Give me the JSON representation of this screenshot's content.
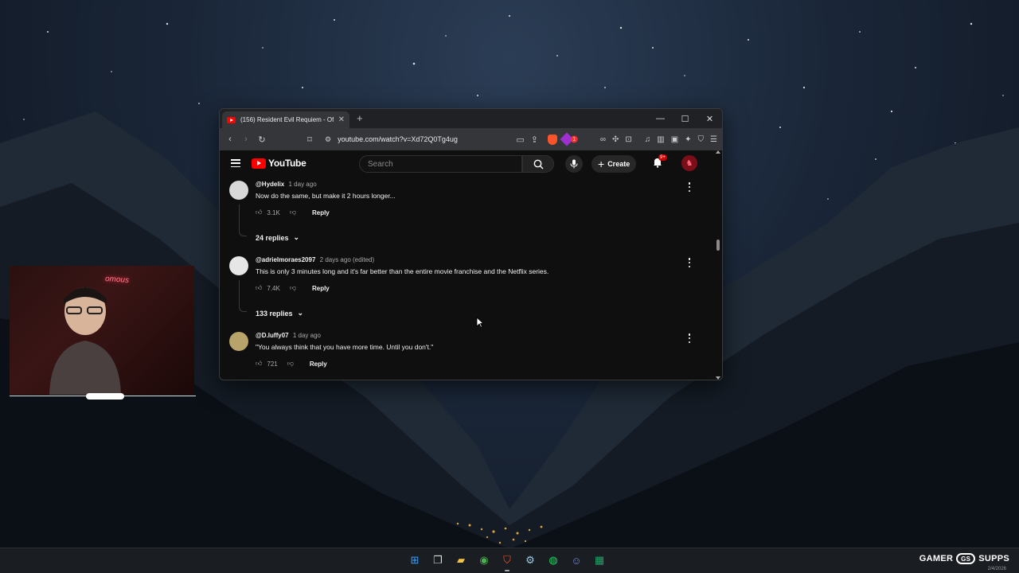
{
  "browser": {
    "tab_title": "(156) Resident Evil Requiem - Of",
    "url": "youtube.com/watch?v=Xd72Q0Tg4ug",
    "reward_badge": "1",
    "window_controls": [
      "—",
      "☐",
      "✕"
    ]
  },
  "youtube": {
    "logo_text": "YouTube",
    "search_placeholder": "Search",
    "create_label": "Create",
    "notification_count": "9+"
  },
  "comments": [
    {
      "author": "@Hydelix",
      "time": "1 day ago",
      "edited": "",
      "text": "Now do the same, but make it 2 hours longer...",
      "likes": "3.1K",
      "reply_label": "Reply",
      "replies": "24 replies",
      "avatar_color": "#d9d9d9"
    },
    {
      "author": "@adrielmoraes2097",
      "time": "2 days ago",
      "edited": "(edited)",
      "text": "This is only 3 minutes long and it's far better than the entire movie franchise and the Netflix series.",
      "likes": "7.4K",
      "reply_label": "Reply",
      "replies": "133 replies",
      "avatar_color": "#e6e6e6"
    },
    {
      "author": "@D.luffy07",
      "time": "1 day ago",
      "edited": "",
      "text": "\"You always think that you have more time. Until you don't.\"",
      "likes": "721",
      "reply_label": "Reply",
      "replies": "",
      "avatar_color": "#b8a46a"
    }
  ],
  "webcam": {
    "neon_text": "omous"
  },
  "taskbar": {
    "brand_left": "GAMER",
    "brand_mark": "GS",
    "brand_right": "SUPPS",
    "date": "2/4/2026"
  }
}
